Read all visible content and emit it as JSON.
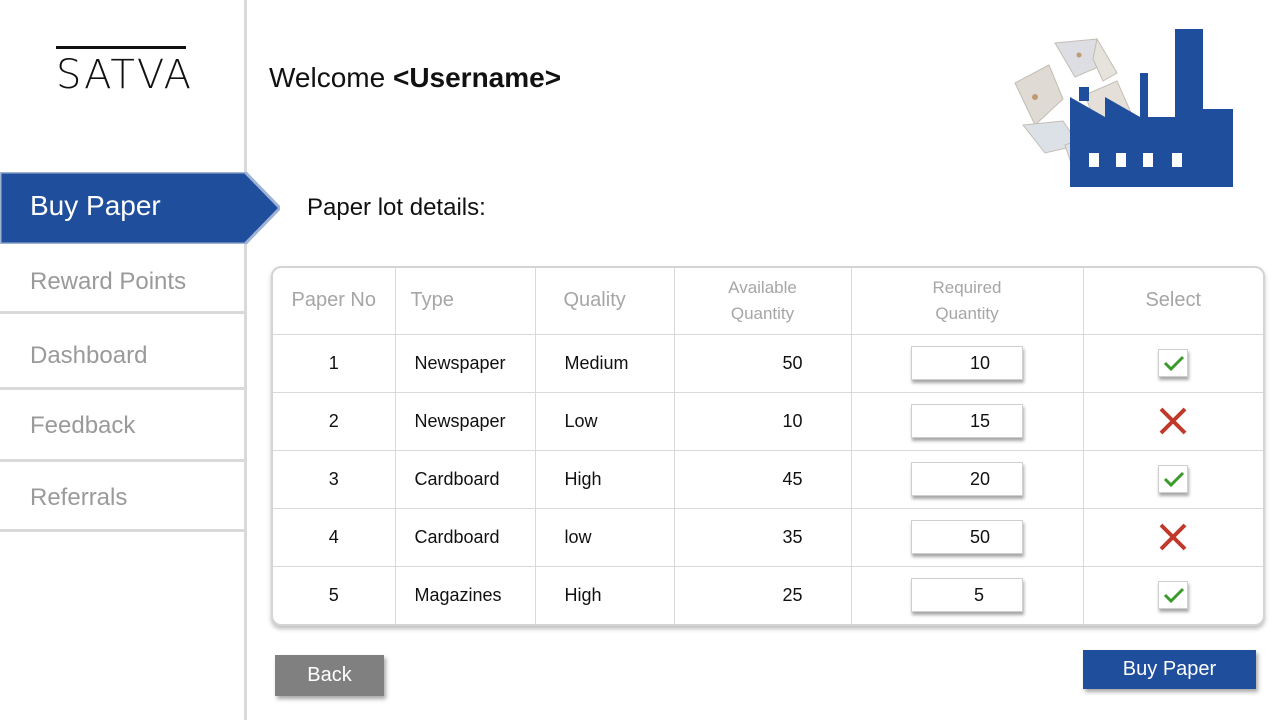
{
  "brand": {
    "logo_text": "SATVA"
  },
  "header": {
    "welcome_prefix": "Welcome ",
    "username": "<Username>",
    "welcome_suffix": ""
  },
  "sidebar": {
    "items": [
      {
        "label": "Buy Paper",
        "active": true
      },
      {
        "label": "Reward Points",
        "active": false
      },
      {
        "label": "Dashboard",
        "active": false
      },
      {
        "label": "Feedback",
        "active": false
      },
      {
        "label": "Referrals",
        "active": false
      }
    ]
  },
  "main": {
    "section_title": "Paper lot details:",
    "table": {
      "headers": {
        "paper_no": "Paper No",
        "type": "Type",
        "quality": "Quality",
        "available_line1": "Available",
        "available_line2": "Quantity",
        "required_line1": "Required",
        "required_line2": "Quantity",
        "select": "Select"
      },
      "rows": [
        {
          "no": "1",
          "type": "Newspaper",
          "quality": "Medium",
          "available": "50",
          "required": "10",
          "selected": true
        },
        {
          "no": "2",
          "type": "Newspaper",
          "quality": "Low",
          "available": "10",
          "required": "15",
          "selected": false
        },
        {
          "no": "3",
          "type": "Cardboard",
          "quality": "High",
          "available": "45",
          "required": "20",
          "selected": true
        },
        {
          "no": "4",
          "type": "Cardboard",
          "quality": "low",
          "available": "35",
          "required": "50",
          "selected": false
        },
        {
          "no": "5",
          "type": "Magazines",
          "quality": "High",
          "available": "25",
          "required": "5",
          "selected": true
        }
      ]
    }
  },
  "buttons": {
    "back": "Back",
    "buy": "Buy Paper"
  },
  "colors": {
    "primary": "#1f4e9c",
    "back_button": "#808080",
    "check": "#3a9a2a",
    "cross": "#c0392b",
    "muted_text": "#9a9a9a"
  }
}
